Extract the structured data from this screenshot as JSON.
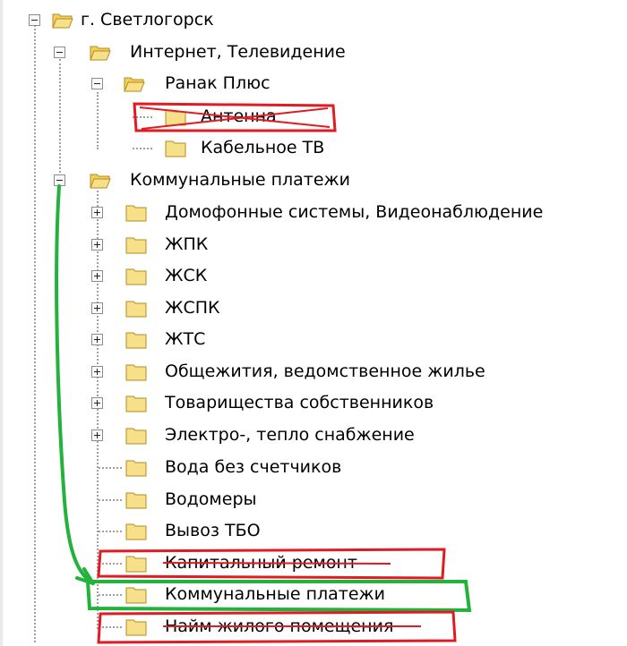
{
  "tree": {
    "root": {
      "label": "г. Светлогорск"
    },
    "internet": {
      "label": "Интернет, Телевидение"
    },
    "ranak": {
      "label": "Ранак Плюс"
    },
    "antenna": {
      "label": "Антенна"
    },
    "cable_tv": {
      "label": "Кабельное ТВ"
    },
    "communal": {
      "label": "Коммунальные платежи"
    },
    "intercom": {
      "label": "Домофонные системы, Видеонаблюдение"
    },
    "zhpk": {
      "label": "ЖПК"
    },
    "zhsk": {
      "label": "ЖСК"
    },
    "zhspk": {
      "label": "ЖСПК"
    },
    "zhts": {
      "label": "ЖТС"
    },
    "dorms": {
      "label": "Общежития, ведомственное жилье"
    },
    "owners": {
      "label": "Товарищества собственников"
    },
    "electro": {
      "label": "Электро-, тепло снабжение"
    },
    "water_no_meter": {
      "label": "Вода без счетчиков"
    },
    "water_meters": {
      "label": "Водомеры"
    },
    "tbo": {
      "label": "Вывоз ТБО"
    },
    "capital_repair": {
      "label": "Капитальный ремонт"
    },
    "communal_payments": {
      "label": "Коммунальные платежи"
    },
    "housing_rent": {
      "label": "Найм жилого помещения"
    }
  },
  "colors": {
    "annotation_red": "#e01b22",
    "annotation_green": "#23b23b",
    "folder_fill": "#f7e08a",
    "folder_stroke": "#b58b1d"
  },
  "icons": {
    "folder_closed": "folder-icon",
    "folder_open": "folder-open-icon",
    "expand": "expand-plus-icon",
    "collapse": "collapse-minus-icon"
  }
}
